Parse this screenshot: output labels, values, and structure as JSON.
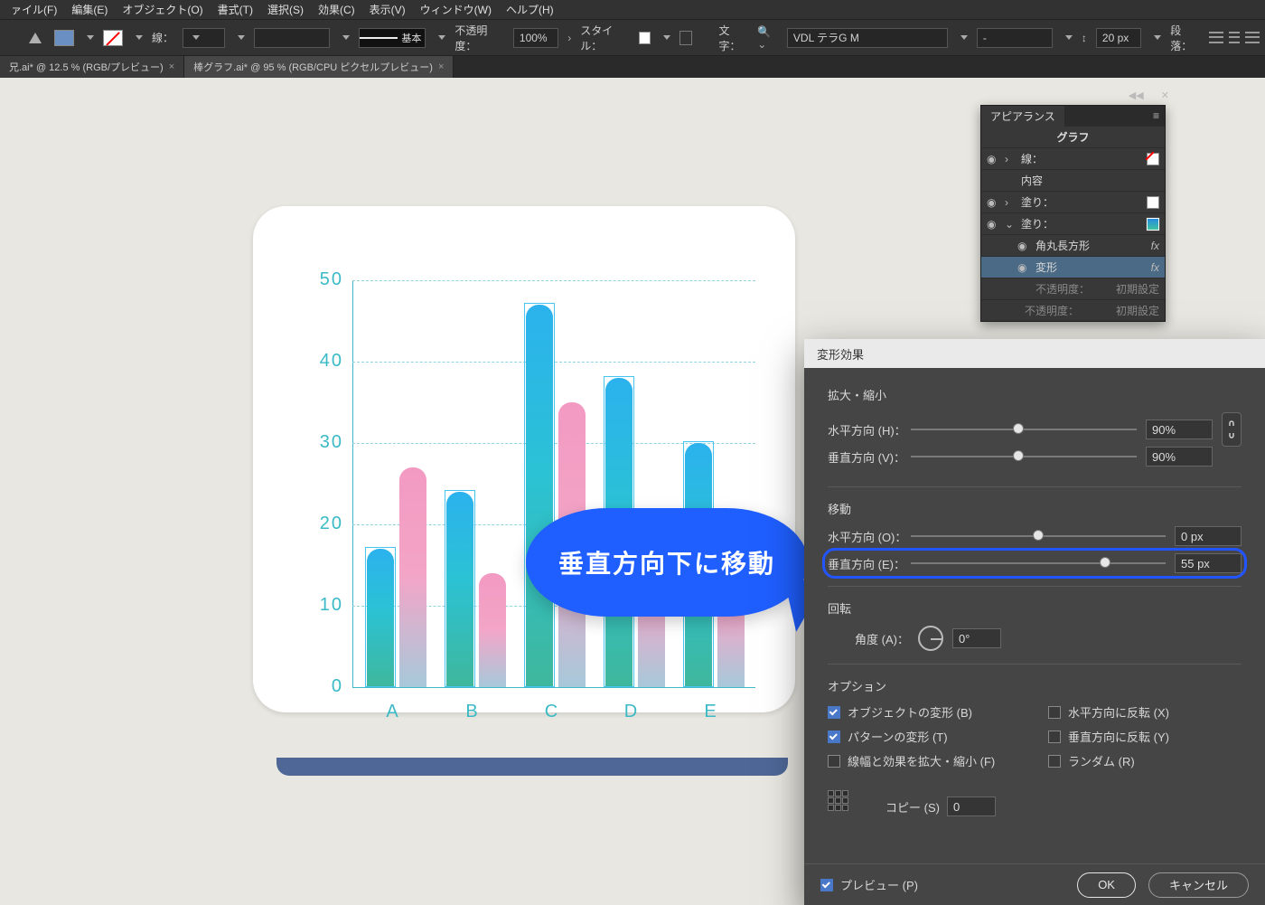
{
  "menubar": [
    "ァイル(F)",
    "編集(E)",
    "オブジェクト(O)",
    "書式(T)",
    "選択(S)",
    "効果(C)",
    "表示(V)",
    "ウィンドウ(W)",
    "ヘルプ(H)"
  ],
  "controlbar": {
    "stroke_label": "線：",
    "graphic_style_text": "基本",
    "opacity_label": "不透明度：",
    "opacity_value": "100%",
    "style_label": "スタイル：",
    "char_label": "文字：",
    "char_value": "VDL テラG M",
    "font_style": "-",
    "font_size": "20 px",
    "para_label": "段落："
  },
  "tabs": [
    {
      "label": "兄.ai* @ 12.5 % (RGB/プレビュー)",
      "active": false
    },
    {
      "label": "棒グラフ.ai* @ 95 % (RGB/CPU ピクセルプレビュー)",
      "active": true
    }
  ],
  "chart_data": {
    "type": "bar",
    "ylim": [
      0,
      50
    ],
    "yticks": [
      0,
      10,
      20,
      30,
      40,
      50
    ],
    "categories": [
      "A",
      "B",
      "C",
      "D",
      "E"
    ],
    "series": [
      {
        "name": "blue",
        "values": [
          17,
          24,
          47,
          38,
          30
        ]
      },
      {
        "name": "pink",
        "values": [
          27,
          14,
          35,
          22,
          19
        ]
      }
    ]
  },
  "bubble_text": "垂直方向下に移動",
  "appearance": {
    "panel_title": "アピアランス",
    "object": "グラフ",
    "row_stroke": "線：",
    "row_content": "内容",
    "row_fill1": "塗り：",
    "row_fill2": "塗り：",
    "row_rrect": "角丸長方形",
    "row_transform": "変形",
    "row_opacity": "不透明度：",
    "row_opacity_val": "初期設定"
  },
  "dialog": {
    "title": "変形効果",
    "sec_scale": "拡大・縮小",
    "scale_h_label": "水平方向 (H)：",
    "scale_h_value": "90%",
    "scale_v_label": "垂直方向 (V)：",
    "scale_v_value": "90%",
    "sec_move": "移動",
    "move_h_label": "水平方向 (O)：",
    "move_h_value": "0 px",
    "move_v_label": "垂直方向 (E)：",
    "move_v_value": "55 px",
    "sec_rotate": "回転",
    "angle_label": "角度 (A)：",
    "angle_value": "0°",
    "sec_options": "オプション",
    "opt_obj": "オブジェクトの変形 (B)",
    "opt_hflip": "水平方向に反転 (X)",
    "opt_pat": "パターンの変形 (T)",
    "opt_vflip": "垂直方向に反転 (Y)",
    "opt_strokes": "線幅と効果を拡大・縮小 (F)",
    "opt_random": "ランダム (R)",
    "copies_label": "コピー (S)",
    "copies_value": "0",
    "preview": "プレビュー (P)",
    "ok": "OK",
    "cancel": "キャンセル"
  }
}
